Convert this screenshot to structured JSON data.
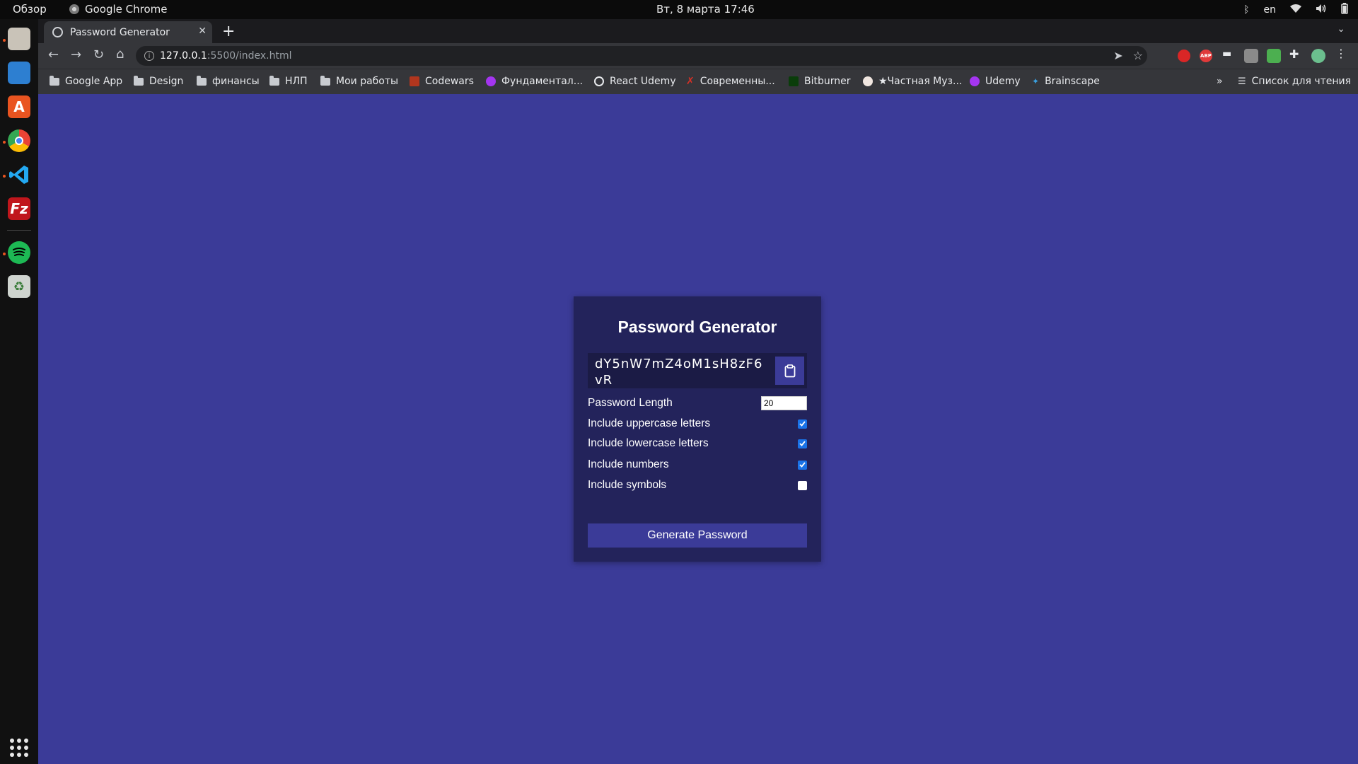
{
  "system_bar": {
    "overview": "Обзор",
    "app_name": "Google Chrome",
    "datetime": "Вт, 8 марта  17:46",
    "lang": "en"
  },
  "browser": {
    "tab_title": "Password Generator",
    "new_tab": "+",
    "url_host": "127.0.0.1",
    "url_path": ":5500/index.html",
    "bookmarks": [
      {
        "label": "Google App",
        "icon": "folder-icon"
      },
      {
        "label": "Design",
        "icon": "folder-icon"
      },
      {
        "label": "финансы",
        "icon": "folder-icon"
      },
      {
        "label": "НЛП",
        "icon": "folder-icon"
      },
      {
        "label": "Мои работы",
        "icon": "folder-icon"
      },
      {
        "label": "Codewars",
        "icon": "codewars-icon"
      },
      {
        "label": "Фундаментал...",
        "icon": "udemy-icon"
      },
      {
        "label": "React Udemy",
        "icon": "globe-icon"
      },
      {
        "label": "Современны...",
        "icon": "site-icon"
      },
      {
        "label": "Bitburner",
        "icon": "bitburner-icon"
      },
      {
        "label": "★Частная Муз...",
        "icon": "site-icon"
      },
      {
        "label": "Udemy",
        "icon": "udemy-icon"
      },
      {
        "label": "Brainscape",
        "icon": "brainscape-icon"
      }
    ],
    "overflow": "»",
    "reading_list": "Список для чтения"
  },
  "app": {
    "title": "Password Generator",
    "password": "dY5nW7mZ4oM1sH8zF6vR",
    "length_label": "Password Length",
    "length_value": "20",
    "options": [
      {
        "label": "Include uppercase letters",
        "checked": true
      },
      {
        "label": "Include lowercase letters",
        "checked": true
      },
      {
        "label": "Include numbers",
        "checked": true
      },
      {
        "label": "Include symbols",
        "checked": false
      }
    ],
    "generate_label": "Generate Password"
  },
  "colors": {
    "page_bg": "#3b3b98",
    "card_bg": "#23235b",
    "result_bg": "#1b1b45",
    "checkbox_on": "#1a73e8"
  }
}
